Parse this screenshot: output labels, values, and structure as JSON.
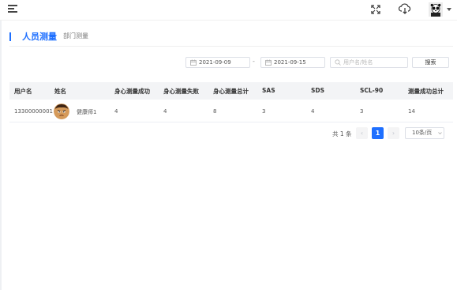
{
  "header": {
    "icons": [
      "menu-fold-icon",
      "fullscreen-icon",
      "cloud-download-icon",
      "user-avatar",
      "caret-down-icon"
    ]
  },
  "tabs": [
    {
      "label": "人员测量",
      "active": true
    },
    {
      "label": "部门测量",
      "active": false
    }
  ],
  "filters": {
    "start_date": "2021-09-09",
    "end_date": "2021-09-15",
    "range_separator": "-",
    "search_placeholder": "用户名/姓名",
    "search_button": "搜索",
    "icons": [
      "calendar-icon",
      "calendar-icon",
      "search-icon"
    ]
  },
  "table": {
    "columns": [
      "用户名",
      "姓名",
      "身心测量成功",
      "身心测量失败",
      "身心测量总计",
      "SAS",
      "SDS",
      "SCL-90",
      "测量成功总计"
    ],
    "rows": [
      {
        "username": "13300000001",
        "name": "健康师1",
        "success": "4",
        "failed": "4",
        "total": "8",
        "sas": "3",
        "sds": "4",
        "scl90": "3",
        "success_total": "14"
      }
    ]
  },
  "pagination": {
    "total_text": "共 1 条",
    "current_page": "1",
    "prev": "‹",
    "next": "›",
    "page_size": "10条/页"
  },
  "colors": {
    "accent": "#1e6fff",
    "header_bg": "#f3f4f6",
    "border": "#dcdfe6"
  }
}
